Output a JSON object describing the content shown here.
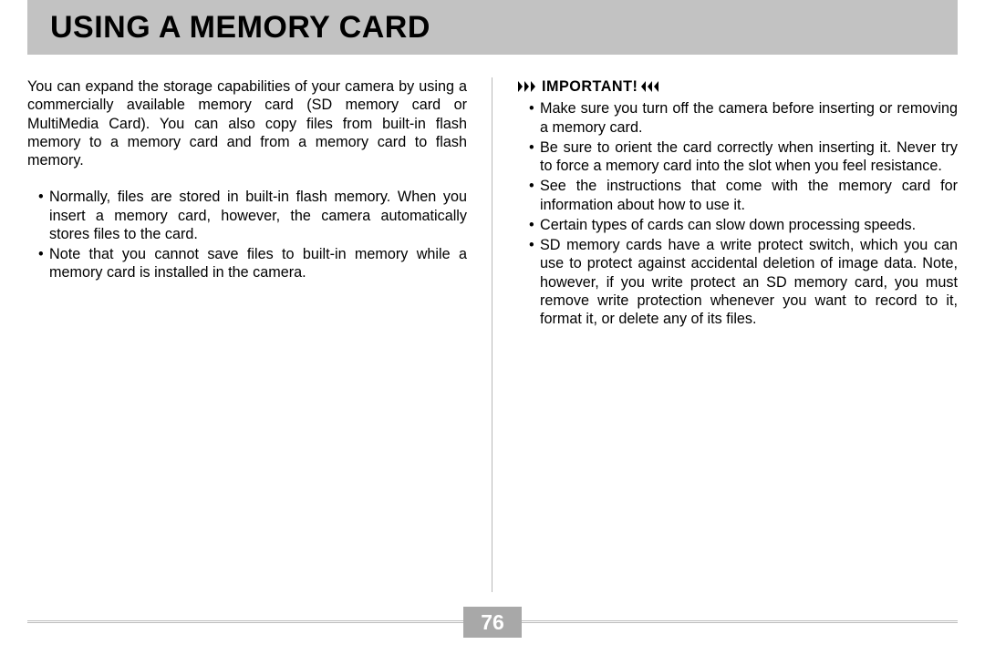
{
  "title": "USING A MEMORY CARD",
  "page_number": "76",
  "left": {
    "intro": "You can expand the storage capabilities of your camera by using a commercially available memory card (SD memory card or MultiMedia Card). You can also copy files from built-in flash memory to a memory card and from a memory card to flash memory.",
    "bullets": [
      "Normally, files are stored in built-in flash memory. When you insert a memory card, however, the camera automatically stores files to the card.",
      "Note that you cannot save files to built-in memory while a memory card is installed in the camera."
    ]
  },
  "right": {
    "important_label": "IMPORTANT!",
    "bullets": [
      "Make sure you turn off the camera before inserting or removing a memory card.",
      "Be sure to orient the card correctly when inserting it. Never try to force a memory card into the slot when you feel resistance.",
      "See the instructions that come with the memory card for information about how to use it.",
      "Certain types of cards can slow down processing speeds.",
      "SD memory cards have a write protect switch, which you can use to protect against accidental deletion of image data. Note, however, if you write protect an SD memory card, you must remove write protection whenever you want to record to it, format it, or delete any of its files."
    ]
  }
}
